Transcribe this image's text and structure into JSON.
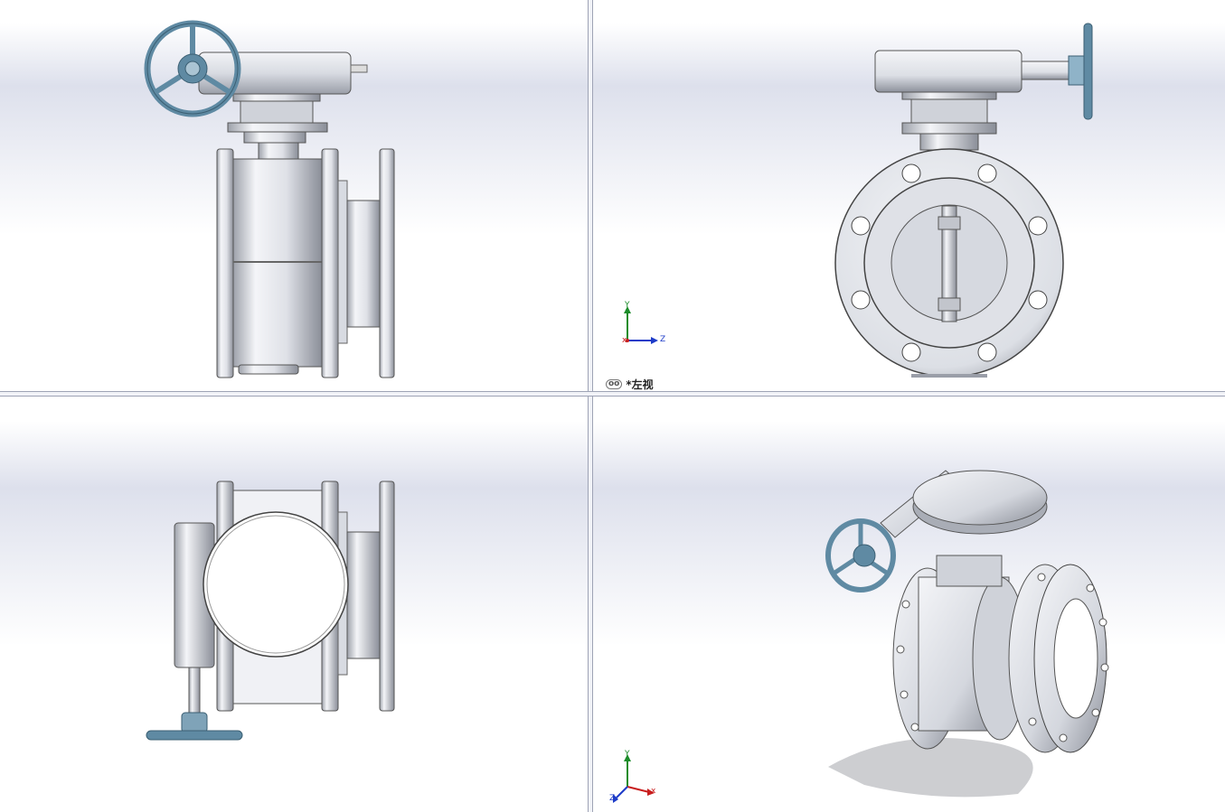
{
  "viewports": {
    "top_left": {
      "name": "front-view"
    },
    "top_right": {
      "name": "left-view",
      "label": "*左视"
    },
    "bottom_left": {
      "name": "top-view"
    },
    "bottom_right": {
      "name": "isometric-view"
    }
  },
  "triad": {
    "x": "x",
    "y": "Y",
    "z": "Z"
  },
  "colors": {
    "metal": "#e4e6ec",
    "metal_dark": "#8e929c",
    "handwheel": "#5f8aa3",
    "split": "#9ea3b5",
    "triad_x": "#c81e1e",
    "triad_y": "#1c8c2a",
    "triad_z": "#1e3cc8"
  }
}
